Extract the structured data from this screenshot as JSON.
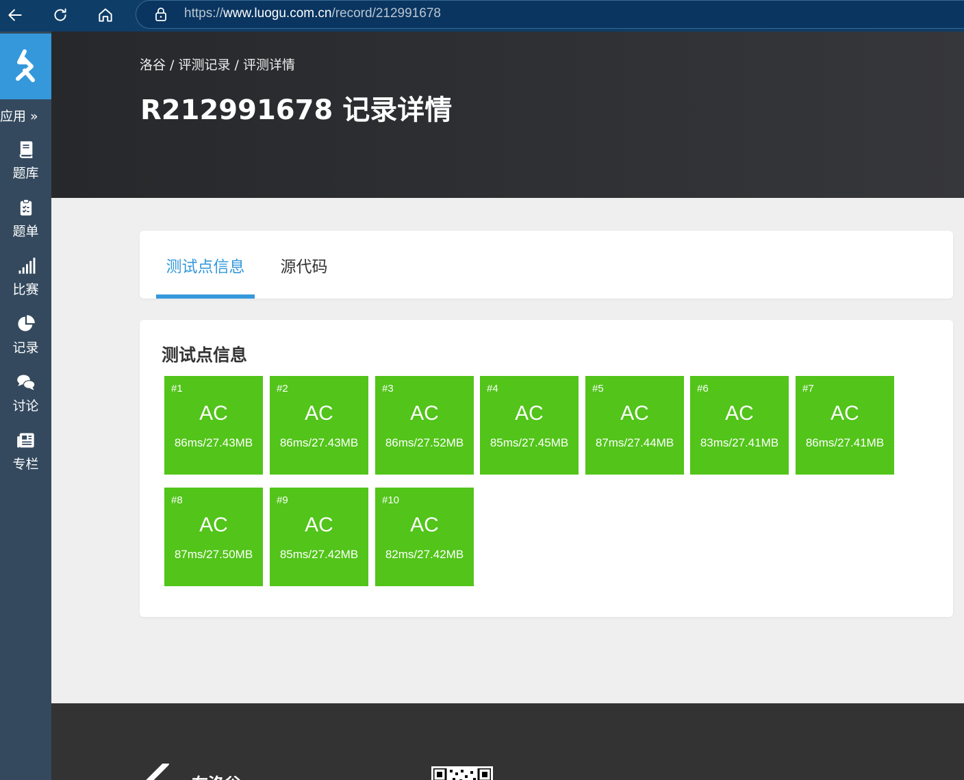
{
  "browser": {
    "url_prefix": "https://",
    "url_domain": "www.luogu.com.cn",
    "url_path": "/record/212991678"
  },
  "sidebar": {
    "apps_label": "应用 »",
    "items": [
      {
        "label": "题库",
        "icon": "book-icon"
      },
      {
        "label": "题单",
        "icon": "clipboard-list-icon"
      },
      {
        "label": "比赛",
        "icon": "signal-bars-icon"
      },
      {
        "label": "记录",
        "icon": "pie-chart-icon"
      },
      {
        "label": "讨论",
        "icon": "comments-icon"
      },
      {
        "label": "专栏",
        "icon": "newspaper-icon"
      }
    ]
  },
  "header": {
    "breadcrumb": [
      "洛谷",
      "评测记录",
      "评测详情"
    ],
    "breadcrumb_sep": " / ",
    "title": "R212991678 记录详情"
  },
  "tabs": [
    {
      "label": "测试点信息",
      "active": true
    },
    {
      "label": "源代码",
      "active": false
    }
  ],
  "tests": {
    "title": "测试点信息",
    "color": "#52c41a",
    "cases": [
      {
        "id": "#1",
        "status": "AC",
        "stats": "86ms/27.43MB"
      },
      {
        "id": "#2",
        "status": "AC",
        "stats": "86ms/27.43MB"
      },
      {
        "id": "#3",
        "status": "AC",
        "stats": "86ms/27.52MB"
      },
      {
        "id": "#4",
        "status": "AC",
        "stats": "85ms/27.45MB"
      },
      {
        "id": "#5",
        "status": "AC",
        "stats": "87ms/27.44MB"
      },
      {
        "id": "#6",
        "status": "AC",
        "stats": "83ms/27.41MB"
      },
      {
        "id": "#7",
        "status": "AC",
        "stats": "86ms/27.41MB"
      },
      {
        "id": "#8",
        "status": "AC",
        "stats": "87ms/27.50MB"
      },
      {
        "id": "#9",
        "status": "AC",
        "stats": "85ms/27.42MB"
      },
      {
        "id": "#10",
        "status": "AC",
        "stats": "82ms/27.42MB"
      }
    ]
  },
  "footer": {
    "brand": "在洛谷"
  },
  "colors": {
    "accent": "#3498db",
    "sidebar": "#34495e",
    "accepted": "#52c41a"
  }
}
